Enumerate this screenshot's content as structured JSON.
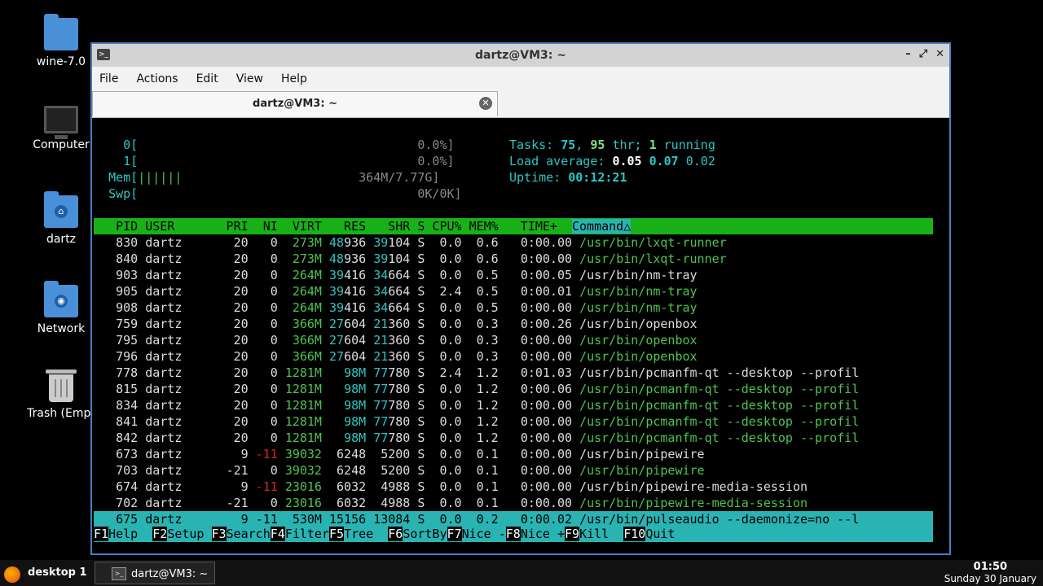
{
  "desktop": {
    "icons": [
      {
        "label": "wine-7.0"
      },
      {
        "label": "Computer"
      },
      {
        "label": "dartz"
      },
      {
        "label": "Network"
      },
      {
        "label": "Trash (Empt"
      }
    ]
  },
  "window": {
    "title": "dartz@VM3: ~",
    "menu": [
      "File",
      "Actions",
      "Edit",
      "View",
      "Help"
    ],
    "tab_label": "dartz@VM3: ~"
  },
  "htop": {
    "cpu0_label": "0[",
    "cpu0_value": "0.0%]",
    "cpu1_label": "1[",
    "cpu1_value": "0.0%]",
    "mem_label": "Mem[",
    "mem_bar": "||||||",
    "mem_value": "364M/7.77G]",
    "swp_label": "Swp[",
    "swp_value": "0K/0K]",
    "tasks_label": "Tasks:",
    "tasks_count": "75",
    "threads_count": "95",
    "thr_label": "thr;",
    "running_count": "1",
    "running_label": "running",
    "load_label": "Load average:",
    "load1": "0.05",
    "load5": "0.07",
    "load15": "0.02",
    "uptime_label": "Uptime:",
    "uptime": "00:12:21",
    "columns": "   PID USER       PRI  NI  VIRT   RES   SHR S CPU% MEM%   TIME+  ",
    "command_header": "Command△",
    "processes": [
      {
        "pid": "830",
        "user": "dartz",
        "pri": "20",
        "ni": "0",
        "virt": "273M",
        "res_a": "48",
        "res_b": "936",
        "shr_a": "39",
        "shr_b": "104",
        "s": "S",
        "cpu": "0.0",
        "mem": "0.6",
        "time": "0:00.00",
        "cmd": "/usr/bin/lxqt-runner",
        "thread": true
      },
      {
        "pid": "840",
        "user": "dartz",
        "pri": "20",
        "ni": "0",
        "virt": "273M",
        "res_a": "48",
        "res_b": "936",
        "shr_a": "39",
        "shr_b": "104",
        "s": "S",
        "cpu": "0.0",
        "mem": "0.6",
        "time": "0:00.00",
        "cmd": "/usr/bin/lxqt-runner",
        "thread": true
      },
      {
        "pid": "903",
        "user": "dartz",
        "pri": "20",
        "ni": "0",
        "virt": "264M",
        "res_a": "39",
        "res_b": "416",
        "shr_a": "34",
        "shr_b": "664",
        "s": "S",
        "cpu": "0.0",
        "mem": "0.5",
        "time": "0:00.05",
        "cmd": "/usr/bin/nm-tray",
        "thread": false
      },
      {
        "pid": "905",
        "user": "dartz",
        "pri": "20",
        "ni": "0",
        "virt": "264M",
        "res_a": "39",
        "res_b": "416",
        "shr_a": "34",
        "shr_b": "664",
        "s": "S",
        "cpu": "2.4",
        "mem": "0.5",
        "time": "0:00.01",
        "cmd": "/usr/bin/nm-tray",
        "thread": true
      },
      {
        "pid": "908",
        "user": "dartz",
        "pri": "20",
        "ni": "0",
        "virt": "264M",
        "res_a": "39",
        "res_b": "416",
        "shr_a": "34",
        "shr_b": "664",
        "s": "S",
        "cpu": "0.0",
        "mem": "0.5",
        "time": "0:00.00",
        "cmd": "/usr/bin/nm-tray",
        "thread": true
      },
      {
        "pid": "759",
        "user": "dartz",
        "pri": "20",
        "ni": "0",
        "virt": "366M",
        "res_a": "27",
        "res_b": "604",
        "shr_a": "21",
        "shr_b": "360",
        "s": "S",
        "cpu": "0.0",
        "mem": "0.3",
        "time": "0:00.26",
        "cmd": "/usr/bin/openbox",
        "thread": false
      },
      {
        "pid": "795",
        "user": "dartz",
        "pri": "20",
        "ni": "0",
        "virt": "366M",
        "res_a": "27",
        "res_b": "604",
        "shr_a": "21",
        "shr_b": "360",
        "s": "S",
        "cpu": "0.0",
        "mem": "0.3",
        "time": "0:00.00",
        "cmd": "/usr/bin/openbox",
        "thread": true
      },
      {
        "pid": "796",
        "user": "dartz",
        "pri": "20",
        "ni": "0",
        "virt": "366M",
        "res_a": "27",
        "res_b": "604",
        "shr_a": "21",
        "shr_b": "360",
        "s": "S",
        "cpu": "0.0",
        "mem": "0.3",
        "time": "0:00.00",
        "cmd": "/usr/bin/openbox",
        "thread": true
      },
      {
        "pid": "778",
        "user": "dartz",
        "pri": "20",
        "ni": "0",
        "virt": "1281M",
        "res_a": "",
        "res_b": "98M",
        "shr_a": "77",
        "shr_b": "780",
        "s": "S",
        "cpu": "2.4",
        "mem": "1.2",
        "time": "0:01.03",
        "cmd": "/usr/bin/pcmanfm-qt --desktop --profil",
        "thread": false
      },
      {
        "pid": "815",
        "user": "dartz",
        "pri": "20",
        "ni": "0",
        "virt": "1281M",
        "res_a": "",
        "res_b": "98M",
        "shr_a": "77",
        "shr_b": "780",
        "s": "S",
        "cpu": "0.0",
        "mem": "1.2",
        "time": "0:00.06",
        "cmd": "/usr/bin/pcmanfm-qt --desktop --profil",
        "thread": true
      },
      {
        "pid": "834",
        "user": "dartz",
        "pri": "20",
        "ni": "0",
        "virt": "1281M",
        "res_a": "",
        "res_b": "98M",
        "shr_a": "77",
        "shr_b": "780",
        "s": "S",
        "cpu": "0.0",
        "mem": "1.2",
        "time": "0:00.00",
        "cmd": "/usr/bin/pcmanfm-qt --desktop --profil",
        "thread": true
      },
      {
        "pid": "841",
        "user": "dartz",
        "pri": "20",
        "ni": "0",
        "virt": "1281M",
        "res_a": "",
        "res_b": "98M",
        "shr_a": "77",
        "shr_b": "780",
        "s": "S",
        "cpu": "0.0",
        "mem": "1.2",
        "time": "0:00.00",
        "cmd": "/usr/bin/pcmanfm-qt --desktop --profil",
        "thread": true
      },
      {
        "pid": "842",
        "user": "dartz",
        "pri": "20",
        "ni": "0",
        "virt": "1281M",
        "res_a": "",
        "res_b": "98M",
        "shr_a": "77",
        "shr_b": "780",
        "s": "S",
        "cpu": "0.0",
        "mem": "1.2",
        "time": "0:00.00",
        "cmd": "/usr/bin/pcmanfm-qt --desktop --profil",
        "thread": true
      },
      {
        "pid": "673",
        "user": "dartz",
        "pri": "9",
        "ni": "-11",
        "virt": "39032",
        "res_a": "",
        "res_b": "6248",
        "shr_a": "",
        "shr_b": "5200",
        "s": "S",
        "cpu": "0.0",
        "mem": "0.1",
        "time": "0:00.00",
        "cmd": "/usr/bin/pipewire",
        "thread": false
      },
      {
        "pid": "703",
        "user": "dartz",
        "pri": "-21",
        "ni": "0",
        "virt": "39032",
        "res_a": "",
        "res_b": "6248",
        "shr_a": "",
        "shr_b": "5200",
        "s": "S",
        "cpu": "0.0",
        "mem": "0.1",
        "time": "0:00.00",
        "cmd": "/usr/bin/pipewire",
        "thread": true
      },
      {
        "pid": "674",
        "user": "dartz",
        "pri": "9",
        "ni": "-11",
        "virt": "23016",
        "res_a": "",
        "res_b": "6032",
        "shr_a": "",
        "shr_b": "4988",
        "s": "S",
        "cpu": "0.0",
        "mem": "0.1",
        "time": "0:00.00",
        "cmd": "/usr/bin/pipewire-media-session",
        "thread": false
      },
      {
        "pid": "702",
        "user": "dartz",
        "pri": "-21",
        "ni": "0",
        "virt": "23016",
        "res_a": "",
        "res_b": "6032",
        "shr_a": "",
        "shr_b": "4988",
        "s": "S",
        "cpu": "0.0",
        "mem": "0.1",
        "time": "0:00.00",
        "cmd": "/usr/bin/pipewire-media-session",
        "thread": true
      },
      {
        "pid": "675",
        "user": "dartz",
        "pri": "9",
        "ni": "-11",
        "virt": "530M",
        "res_a": "15",
        "res_b": "156",
        "shr_a": "13",
        "shr_b": "084",
        "s": "S",
        "cpu": "0.0",
        "mem": "0.2",
        "time": "0:00.02",
        "cmd": "/usr/bin/pulseaudio --daemonize=no --l",
        "thread": false,
        "selected": true
      }
    ],
    "fkeys": [
      {
        "key": "F1",
        "label": "Help  "
      },
      {
        "key": "F2",
        "label": "Setup "
      },
      {
        "key": "F3",
        "label": "Search"
      },
      {
        "key": "F4",
        "label": "Filter"
      },
      {
        "key": "F5",
        "label": "Tree  "
      },
      {
        "key": "F6",
        "label": "SortBy"
      },
      {
        "key": "F7",
        "label": "Nice -"
      },
      {
        "key": "F8",
        "label": "Nice +"
      },
      {
        "key": "F9",
        "label": "Kill  "
      },
      {
        "key": "F10",
        "label": "Quit"
      }
    ]
  },
  "taskbar": {
    "desktop_label": "desktop 1",
    "task_label": "dartz@VM3: ~",
    "time": "01:50",
    "date": "Sunday 30 January"
  }
}
